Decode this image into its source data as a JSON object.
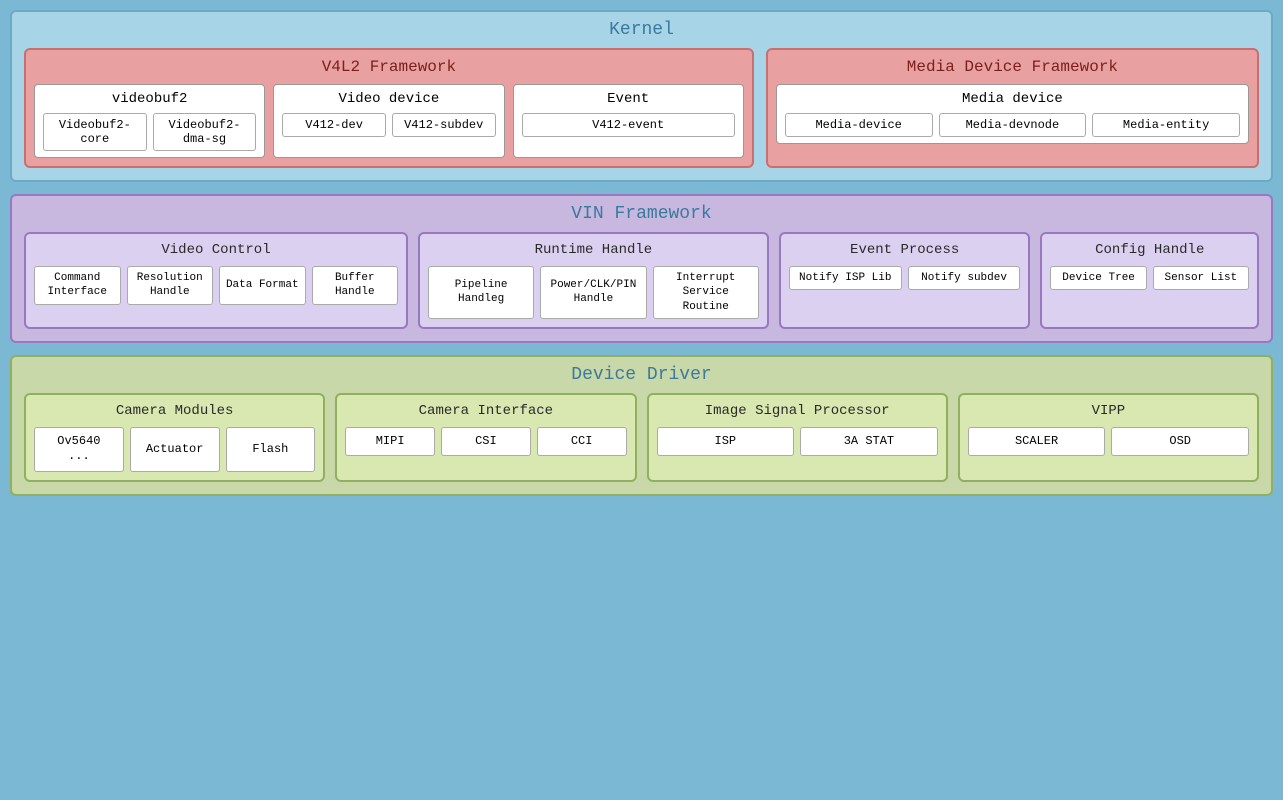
{
  "kernel": {
    "title": "Kernel",
    "v4l2": {
      "title": "V4L2 Framework",
      "videobuf2": {
        "title": "videobuf2",
        "items": [
          "Videobuf2-core",
          "Videobuf2-dma-sg"
        ]
      },
      "video_device": {
        "title": "Video device",
        "items": [
          "V412-dev",
          "V412-subdev"
        ]
      },
      "event": {
        "title": "Event",
        "items": [
          "V412-event"
        ]
      }
    },
    "media_device": {
      "title": "Media Device Framework",
      "media_dev": {
        "title": "Media device",
        "items": [
          "Media-device",
          "Media-devnode",
          "Media-entity"
        ]
      }
    }
  },
  "vin": {
    "title": "VIN Framework",
    "video_control": {
      "title": "Video Control",
      "items": [
        "Command Interface",
        "Resolution Handle",
        "Data Format",
        "Buffer Handle"
      ]
    },
    "runtime_handle": {
      "title": "Runtime Handle",
      "items": [
        "Pipeline Handleg",
        "Power/CLK/PIN Handle",
        "Interrupt Service Routine"
      ]
    },
    "event_process": {
      "title": "Event Process",
      "items": [
        "Notify ISP Lib",
        "Notify subdev"
      ]
    },
    "config_handle": {
      "title": "Config Handle",
      "items": [
        "Device Tree",
        "Sensor List"
      ]
    }
  },
  "device_driver": {
    "title": "Device Driver",
    "camera_modules": {
      "title": "Camera Modules",
      "items": [
        "Ov5640 ...",
        "Actuator",
        "Flash"
      ]
    },
    "camera_interface": {
      "title": "Camera Interface",
      "items": [
        "MIPI",
        "CSI",
        "CCI"
      ]
    },
    "isp": {
      "title": "Image Signal Processor",
      "items": [
        "ISP",
        "3A STAT"
      ]
    },
    "vipp": {
      "title": "VIPP",
      "items": [
        "SCALER",
        "OSD"
      ]
    }
  }
}
